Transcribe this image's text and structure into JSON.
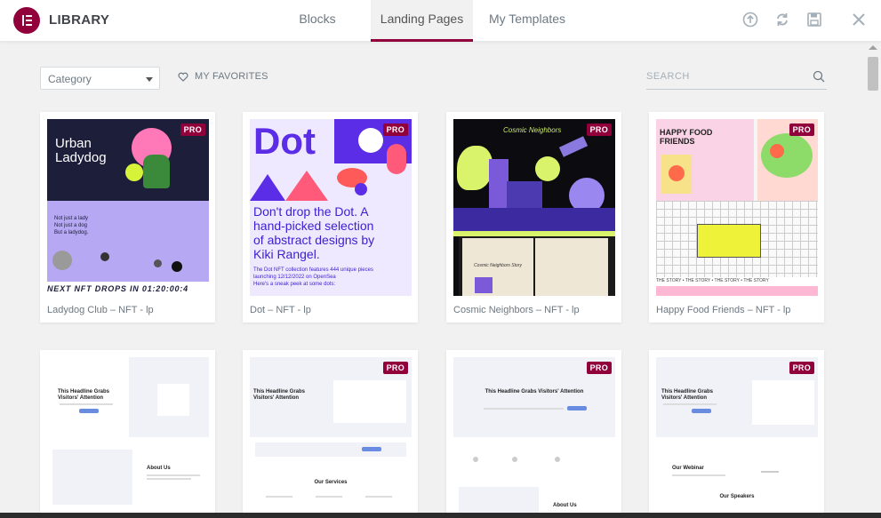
{
  "header": {
    "brand": "LIBRARY",
    "tabs": [
      {
        "label": "Blocks"
      },
      {
        "label": "Landing Pages"
      },
      {
        "label": "My Templates"
      }
    ],
    "accent": "#92003b"
  },
  "filters": {
    "category_label": "Category",
    "favorites_label": "MY FAVORITES",
    "search_placeholder": "SEARCH"
  },
  "cards": [
    {
      "title": "Ladydog Club – NFT - lp",
      "pro": "PRO",
      "thumb": {
        "headline": "Urban Ladydog",
        "lines": [
          "Not just a lady",
          "Not just a dog",
          "But a ladydog."
        ],
        "ticker": "NEXT NFT DROPS IN 01:20:00:4"
      }
    },
    {
      "title": "Dot – NFT - lp",
      "pro": "PRO",
      "thumb": {
        "headline": "Dot",
        "lines": [
          "Don't drop the Dot. A",
          "hand-picked selection",
          "of abstract designs by",
          "Kiki Rangel."
        ],
        "sub": [
          "The Dot NFT collection features 444 unique pieces",
          "launching 12/12/2022 on OpenSea",
          "Here's a sneak peek at some dots:"
        ]
      }
    },
    {
      "title": "Cosmic Neighbors – NFT - lp",
      "pro": "PRO",
      "thumb": {
        "headline": "Cosmic Neighbors",
        "book": "Cosmic Neighbors Story"
      }
    },
    {
      "title": "Happy Food Friends – NFT - lp",
      "pro": "PRO",
      "thumb": {
        "headline": "HAPPY FOOD FRIENDS",
        "ticker": "THE STORY • THE STORY • THE STORY • THE STORY"
      }
    },
    {
      "title": "",
      "pro": "",
      "thumb": {
        "headline": "This Headline Grabs Visitors' Attention",
        "section": "About Us"
      }
    },
    {
      "title": "",
      "pro": "PRO",
      "thumb": {
        "headline": "This Headline Grabs Visitors' Attention",
        "section": "Our Services"
      }
    },
    {
      "title": "",
      "pro": "PRO",
      "thumb": {
        "headline": "This Headline Grabs Visitors' Attention",
        "section": "About Us"
      }
    },
    {
      "title": "",
      "pro": "PRO",
      "thumb": {
        "headline": "This Headline Grabs Visitors' Attention",
        "section": "Our Webinar",
        "section2": "Our Speakers"
      }
    }
  ]
}
